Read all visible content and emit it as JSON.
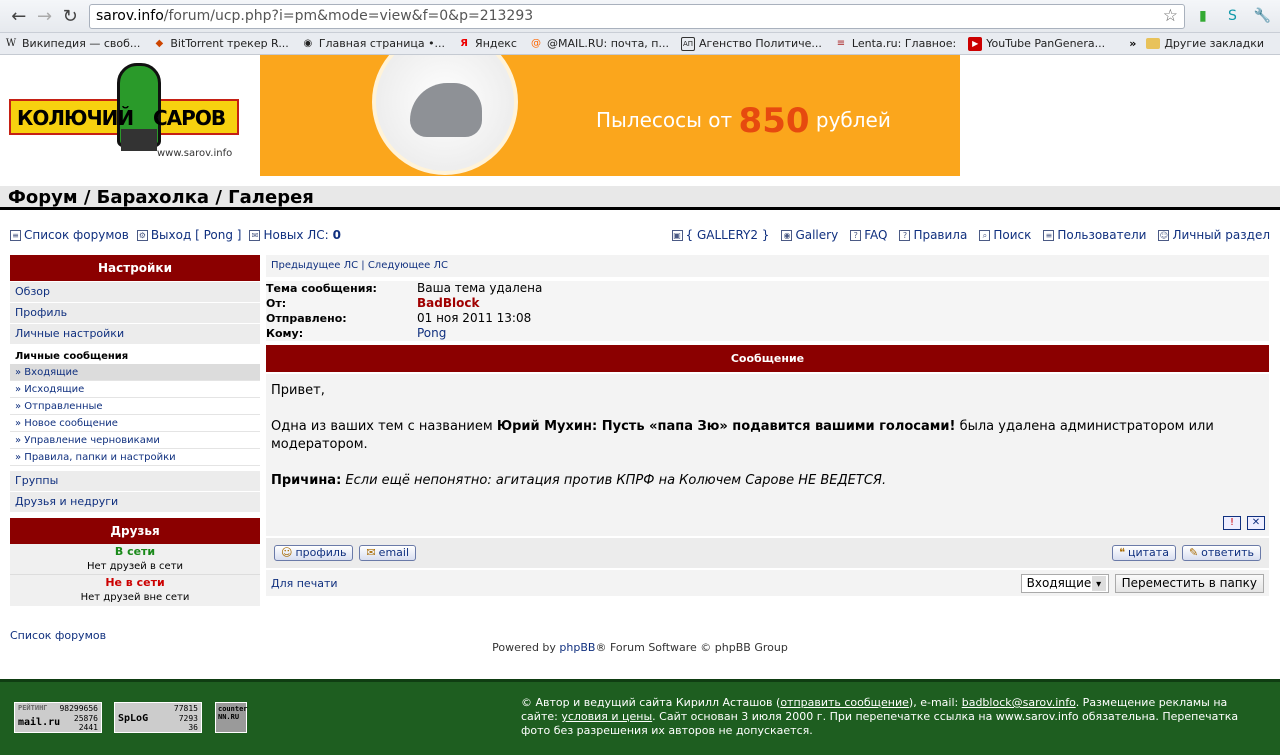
{
  "browser": {
    "url_host": "sarov.info",
    "url_path": "/forum/ucp.php?i=pm&mode=view&f=0&p=213293",
    "bookmarks": [
      {
        "icon": "W",
        "label": "Википедия — своб..."
      },
      {
        "icon": "◆",
        "label": "BitTorrent трекер R..."
      },
      {
        "icon": "◉",
        "label": "Главная страница •..."
      },
      {
        "icon": "Я",
        "label": "Яндекс"
      },
      {
        "icon": "@",
        "label": "@MAIL.RU: почта, п..."
      },
      {
        "icon": "АП",
        "label": "Агенство Политиче..."
      },
      {
        "icon": "≡",
        "label": "Lenta.ru: Главное:"
      },
      {
        "icon": "▶",
        "label": "YouTube PanGenera..."
      }
    ],
    "bookmarks_more": "»",
    "other_bookmarks": "Другие закладки"
  },
  "header": {
    "logo_word1": "КОЛЮЧИЙ",
    "logo_word2": "САРОВ",
    "logo_url": "www.sarov.info",
    "banner_text": "Пылесосы от",
    "banner_number": "850",
    "banner_unit": "рублей",
    "forum_title": "Форум / Барахолка / Галерея"
  },
  "nav": {
    "forum_list": "Список форумов",
    "logout": "Выход [ Pong ]",
    "new_pm_label": "Новых ЛС:",
    "new_pm_count": "0",
    "gallery2": "{ GALLERY2 }",
    "gallery": "Gallery",
    "faq": "FAQ",
    "rules": "Правила",
    "search": "Поиск",
    "users": "Пользователи",
    "personal": "Личный раздел"
  },
  "sidebar": {
    "title": "Настройки",
    "overview": "Обзор",
    "profile": "Профиль",
    "personal_settings": "Личные настройки",
    "pm_section": "Личные сообщения",
    "pm_items": [
      "» Входящие",
      "» Исходящие",
      "» Отправленные",
      "» Новое сообщение",
      "» Управление черновиками",
      "» Правила, папки и настройки"
    ],
    "groups": "Группы",
    "friends_foes": "Друзья и недруги",
    "friends_title": "Друзья",
    "online_label": "В сети",
    "online_text": "Нет друзей в сети",
    "offline_label": "Не в сети",
    "offline_text": "Нет друзей вне сети"
  },
  "message": {
    "prev": "Предыдущее ЛС",
    "sep": "|",
    "next": "Следующее ЛС",
    "subject_label": "Тема сообщения:",
    "subject": "Ваша тема удалена",
    "from_label": "От:",
    "from": "BadBlock",
    "sent_label": "Отправлено:",
    "sent": "01 ноя 2011 13:08",
    "to_label": "Кому:",
    "to": "Pong",
    "header": "Сообщение",
    "greeting": "Привет,",
    "body_pre": "Одна из ваших тем с названием",
    "topic_title": "Юрий Мухин: Пусть «папа Зю» подавится вашими голосами!",
    "body_post": "была удалена администратором или модератором.",
    "reason_label": "Причина:",
    "reason": "Если ещё непонятно: агитация против КПРФ на Колючем Сарове НЕ ВЕДЕТСЯ.",
    "btn_profile": "профиль",
    "btn_email": "email",
    "btn_quote": "цитата",
    "btn_reply": "ответить",
    "print": "Для печати",
    "folder_selected": "Входящие",
    "move_button": "Переместить в папку"
  },
  "bottom": {
    "forum_list": "Список форумов",
    "powered_pre": "Powered by",
    "powered_link": "phpBB",
    "powered_post": "® Forum Software © phpBB Group"
  },
  "footer": {
    "c1_label": "РЕЙТИНГ",
    "c1_brand": "mail.ru",
    "c1_nums": [
      "98299656",
      "25876",
      "2441"
    ],
    "c2_brand": "SpLoG",
    "c2_nums": [
      "77815",
      "7293",
      "36"
    ],
    "c3_label": "counter NN.RU",
    "text_1": "© Автор и ведущий сайта Кирилл Асташов (",
    "link_msg": "отправить сообщение",
    "text_2": "), e-mail:",
    "email": "badblock@sarov.info",
    "text_3": ". Размещение рекламы на сайте:",
    "link_terms": "условия и цены",
    "text_4": ". Сайт основан 3 июля 2000 г. При перепечатке ссылка на www.sarov.info обязательна. Перепечатка фото без разрешения их авторов не допускается."
  }
}
